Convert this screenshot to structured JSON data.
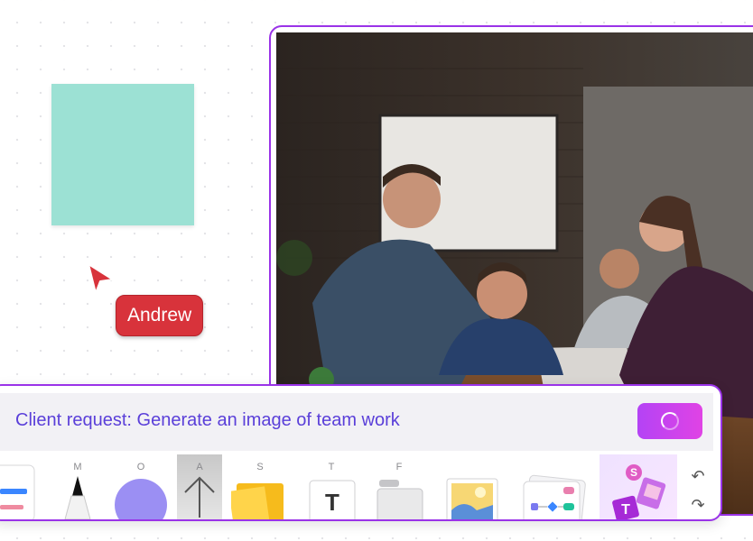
{
  "canvas": {
    "sticky_note_color": "#9ce1d4",
    "collaborator": {
      "name": "Andrew",
      "cursor_color": "#d8333b"
    }
  },
  "image_frame": {
    "border_color": "#9a33e8",
    "image_description_icon": "photo-icon"
  },
  "ai_panel": {
    "prompt": "Client request: Generate an image of team work",
    "generate_button_icon": "spinner-icon"
  },
  "toolbar": {
    "tools": [
      {
        "name": "cards",
        "shortcut": "",
        "icon": "cards-icon"
      },
      {
        "name": "marker",
        "shortcut": "M",
        "icon": "marker-icon"
      },
      {
        "name": "shape",
        "shortcut": "O",
        "icon": "circle-shape-icon"
      },
      {
        "name": "arrow",
        "shortcut": "A",
        "icon": "arrow-icon"
      },
      {
        "name": "sticky",
        "shortcut": "S",
        "icon": "sticky-note-icon"
      },
      {
        "name": "text",
        "shortcut": "T",
        "icon": "text-icon"
      },
      {
        "name": "frame",
        "shortcut": "F",
        "icon": "frame-icon"
      },
      {
        "name": "image",
        "shortcut": "",
        "icon": "image-icon"
      },
      {
        "name": "templates",
        "shortcut": "",
        "icon": "flowchart-icon"
      },
      {
        "name": "ai",
        "shortcut": "",
        "icon": "ai-icon"
      }
    ],
    "undo_icon": "undo-icon",
    "redo_icon": "redo-icon"
  }
}
